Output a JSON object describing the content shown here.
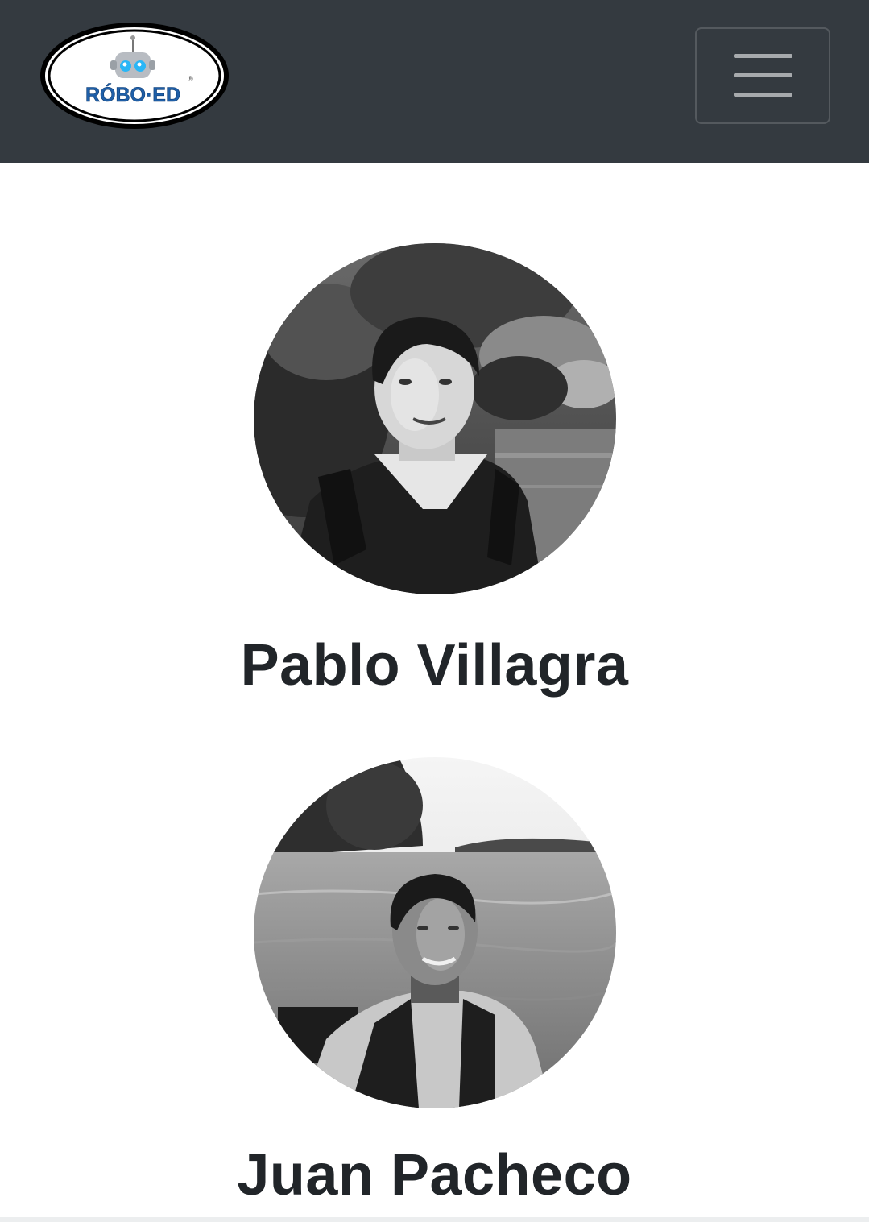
{
  "header": {
    "brand": {
      "logo_text": "RÓBO·ED",
      "registered_mark": "®"
    },
    "menu_icon": "hamburger-menu-icon"
  },
  "team": [
    {
      "name": "Pablo Villagra"
    },
    {
      "name": "Juan Pacheco"
    }
  ],
  "colors": {
    "navbar_bg": "#343a40",
    "page_bg": "#ffffff",
    "name_text": "#212529",
    "logo_blue": "#1f5fa8",
    "logo_eyes": "#29b6f6"
  }
}
